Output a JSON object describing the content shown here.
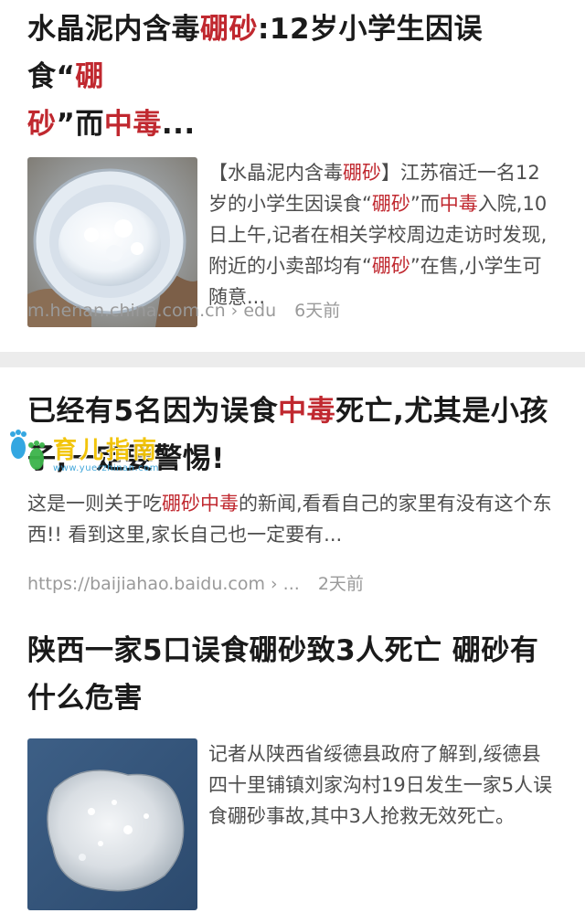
{
  "results": [
    {
      "title_parts": [
        "水晶泥内含毒",
        "硼砂",
        ":12岁小学生因误食“",
        "硼",
        "砂",
        "”而",
        "中毒",
        "..."
      ],
      "desc_parts": [
        "【水晶泥内含毒",
        "硼砂",
        "】江苏宿迁一名12岁的小学生因误食“",
        "硼砂",
        "”而",
        "中毒",
        "入院,10日上午,记者在相关学校周边走访时发现,附近的小卖部均有“",
        "硼砂",
        "”在售,小学生可随意..."
      ],
      "source": "m.henan.china.com.cn › edu",
      "time": "6天前"
    },
    {
      "title_parts": [
        "已经有5名因为误食",
        "中毒",
        "死亡,尤其是小孩子,一定要警惕!"
      ],
      "desc_parts": [
        "这是一则关于吃",
        "硼砂中毒",
        "的新闻,看看自己的家里有没有这个东西!! 看到这里,家长自己也一定要有..."
      ],
      "source": "https://baijiahao.baidu.com › ...",
      "time": "2天前"
    },
    {
      "title": "陕西一家5口误食硼砂致3人死亡 硼砂有什么危害",
      "desc": "记者从陕西省绥德县政府了解到,绥德县四十里铺镇刘家沟村19日发生一家5人误食硼砂事故,其中3人抢救无效死亡。"
    }
  ],
  "watermark": {
    "text": "育儿指南",
    "url": "www.yuerzhinan.com",
    "icon": "footprints-icon"
  },
  "colors": {
    "highlight": "#c0282f",
    "title": "#1a1a1a",
    "meta": "#9a9a9a",
    "divider": "#ececec"
  }
}
